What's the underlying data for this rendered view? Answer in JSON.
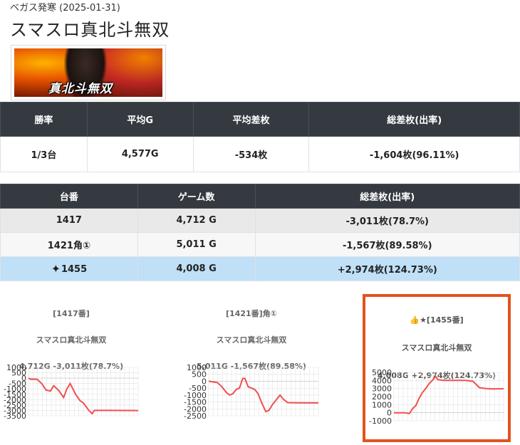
{
  "header": {
    "subtitle": "ベガス発寒 (2025-01-31)",
    "title": "スマスロ真北斗無双",
    "banner_logo": "真北斗無双"
  },
  "summary": {
    "headers": [
      "勝率",
      "平均G",
      "平均差枚",
      "総差枚(出率)"
    ],
    "values": [
      "1/3台",
      "4,577G",
      "-534枚",
      "-1,604枚(96.11%)"
    ]
  },
  "machines": {
    "headers": [
      "台番",
      "ゲーム数",
      "総差枚(出率)"
    ],
    "rows": [
      {
        "number": "1417",
        "games": "4,712 G",
        "diff": "-3,011枚(78.7%)"
      },
      {
        "number": "1421角①",
        "games": "5,011 G",
        "diff": "-1,567枚(89.58%)"
      },
      {
        "number": "1455",
        "games": "4,008 G",
        "diff": "+2,974枚(124.73%)",
        "icon": "sparkles-icon"
      }
    ]
  },
  "graphs": [
    {
      "label": "[1417番]",
      "name": "スマスロ真北斗無双",
      "stats": "4,712G -3,011枚(78.7%)",
      "y_ticks": [
        "1000",
        "500",
        "0",
        "-500",
        "-1000",
        "-1500",
        "-2000",
        "-2500",
        "-3000",
        "-3500"
      ],
      "y_min": -3500,
      "y_max": 1000,
      "points": [
        [
          0,
          0
        ],
        [
          0.02,
          -100
        ],
        [
          0.05,
          -100
        ],
        [
          0.08,
          -120
        ],
        [
          0.12,
          -500
        ],
        [
          0.16,
          -1100
        ],
        [
          0.2,
          -1200
        ],
        [
          0.23,
          -700
        ],
        [
          0.28,
          -1200
        ],
        [
          0.32,
          -1800
        ],
        [
          0.35,
          -1000
        ],
        [
          0.38,
          -500
        ],
        [
          0.43,
          -1500
        ],
        [
          0.47,
          -2100
        ],
        [
          0.5,
          -2300
        ],
        [
          0.55,
          -3000
        ],
        [
          0.58,
          -3300
        ],
        [
          0.6,
          -3000
        ],
        [
          0.75,
          -3000
        ],
        [
          1,
          -3011
        ]
      ]
    },
    {
      "label": "[1421番]角①",
      "name": "スマスロ真北斗無双",
      "stats": "5,011G -1,567枚(89.58%)",
      "y_ticks": [
        "1000",
        "500",
        "0",
        "-500",
        "-1000",
        "-1500",
        "-2000",
        "-2500"
      ],
      "y_min": -2500,
      "y_max": 1000,
      "points": [
        [
          0,
          0
        ],
        [
          0.04,
          -50
        ],
        [
          0.08,
          -100
        ],
        [
          0.12,
          -400
        ],
        [
          0.16,
          -800
        ],
        [
          0.19,
          -1000
        ],
        [
          0.22,
          -900
        ],
        [
          0.25,
          -600
        ],
        [
          0.28,
          -500
        ],
        [
          0.31,
          200
        ],
        [
          0.33,
          200
        ],
        [
          0.36,
          -400
        ],
        [
          0.39,
          -500
        ],
        [
          0.42,
          -600
        ],
        [
          0.45,
          -900
        ],
        [
          0.48,
          -1500
        ],
        [
          0.52,
          -2200
        ],
        [
          0.55,
          -2100
        ],
        [
          0.58,
          -1700
        ],
        [
          0.62,
          -1300
        ],
        [
          0.65,
          -1000
        ],
        [
          0.68,
          -1300
        ],
        [
          0.72,
          -1550
        ],
        [
          0.8,
          -1560
        ],
        [
          1,
          -1567
        ]
      ]
    },
    {
      "label": "👍★[1455番]",
      "name": "スマスロ真北斗無双",
      "stats": "4,008G +2,974枚(124.73%)",
      "y_ticks": [
        "5000",
        "4000",
        "3000",
        "2000",
        "1000",
        "0",
        "-1000"
      ],
      "y_min": -1000,
      "y_max": 5000,
      "points": [
        [
          0,
          0
        ],
        [
          0.05,
          0
        ],
        [
          0.1,
          0
        ],
        [
          0.14,
          -100
        ],
        [
          0.17,
          500
        ],
        [
          0.2,
          900
        ],
        [
          0.23,
          1800
        ],
        [
          0.26,
          2500
        ],
        [
          0.29,
          3000
        ],
        [
          0.32,
          3600
        ],
        [
          0.35,
          4000
        ],
        [
          0.38,
          4500
        ],
        [
          0.4,
          4100
        ],
        [
          0.45,
          4000
        ],
        [
          0.55,
          4000
        ],
        [
          0.65,
          4000
        ],
        [
          0.72,
          3900
        ],
        [
          0.78,
          3100
        ],
        [
          0.84,
          3000
        ],
        [
          0.9,
          2950
        ],
        [
          1,
          2974
        ]
      ]
    }
  ],
  "colors": {
    "header_bg": "#343a40",
    "row_highlight": "#bfe0f6",
    "graph_line": "#f24e4e",
    "card_border": "#e2531d"
  }
}
